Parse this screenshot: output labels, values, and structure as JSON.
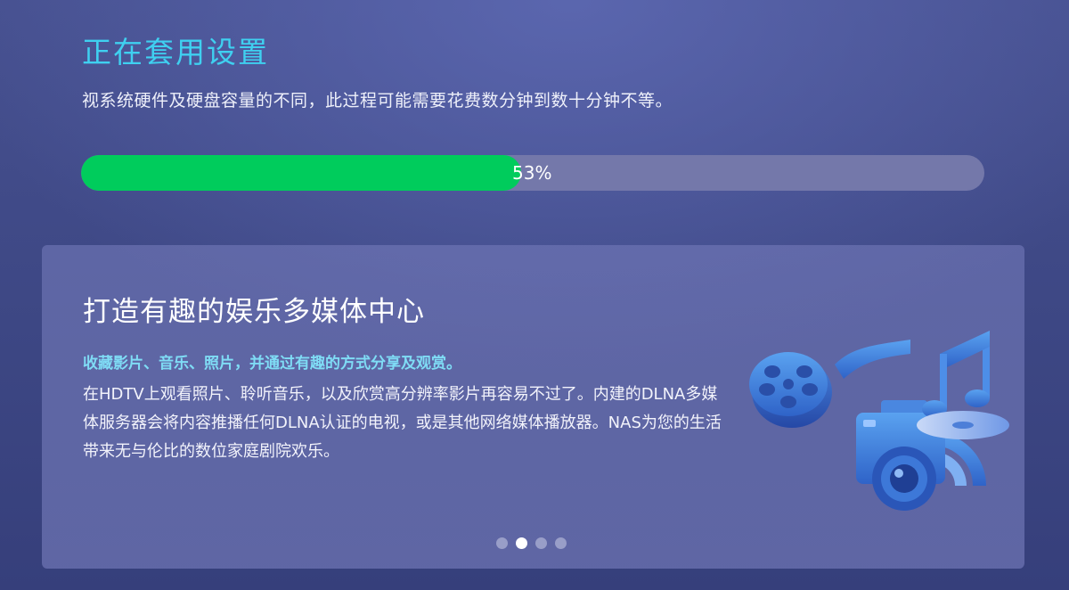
{
  "header": {
    "title": "正在套用设置",
    "subtitle": "视系统硬件及硬盘容量的不同，此过程可能需要花费数分钟到数十分钟不等。"
  },
  "progress": {
    "value": 53,
    "label": "53%"
  },
  "card": {
    "title": "打造有趣的娱乐多媒体中心",
    "highlight": "收藏影片、音乐、照片，并通过有趣的方式分享及观赏。",
    "body": "在HDTV上观看照片、聆听音乐，以及欣赏高分辨率影片再容易不过了。内建的DLNA多媒体服务器会将内容推播任何DLNA认证的电视，或是其他网络媒体播放器。NAS为您的生活带来无与伦比的数位家庭剧院欢乐。",
    "illustration_icons": [
      "film-reel-icon",
      "camera-icon",
      "music-note-icon",
      "disc-icon"
    ]
  },
  "carousel": {
    "total": 4,
    "active_index": 1
  },
  "colors": {
    "accent_title": "#3fd0f0",
    "progress_fill": "#00cc5c",
    "highlight_text": "#7fdcf5"
  }
}
